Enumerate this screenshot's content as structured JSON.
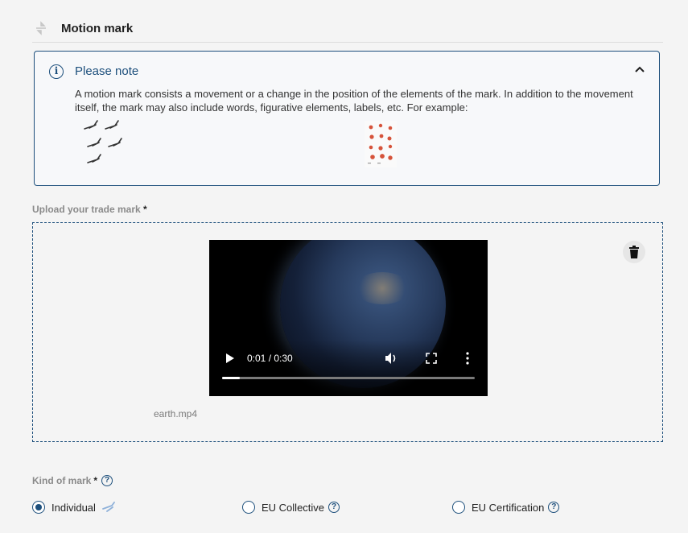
{
  "section": {
    "title": "Motion mark"
  },
  "note": {
    "title": "Please note",
    "body": "A motion mark consists a movement or a change in the position of the elements of the mark. In addition to the movement itself, the mark may also include words, figurative elements, labels, etc. For example:"
  },
  "upload": {
    "label": "Upload your trade mark",
    "required_marker": "*",
    "file_name": "earth.mp4",
    "video": {
      "time": "0:01 / 0:30",
      "progress_fraction": 0.07
    }
  },
  "kind": {
    "label": "Kind of mark",
    "required_marker": "*",
    "help_glyph": "?",
    "options": [
      {
        "label": "Individual",
        "selected": true
      },
      {
        "label": "EU Collective",
        "selected": false
      },
      {
        "label": "EU Certification",
        "selected": false
      }
    ]
  },
  "colors": {
    "accent": "#1d4f7c",
    "background": "#f4f4f4"
  }
}
